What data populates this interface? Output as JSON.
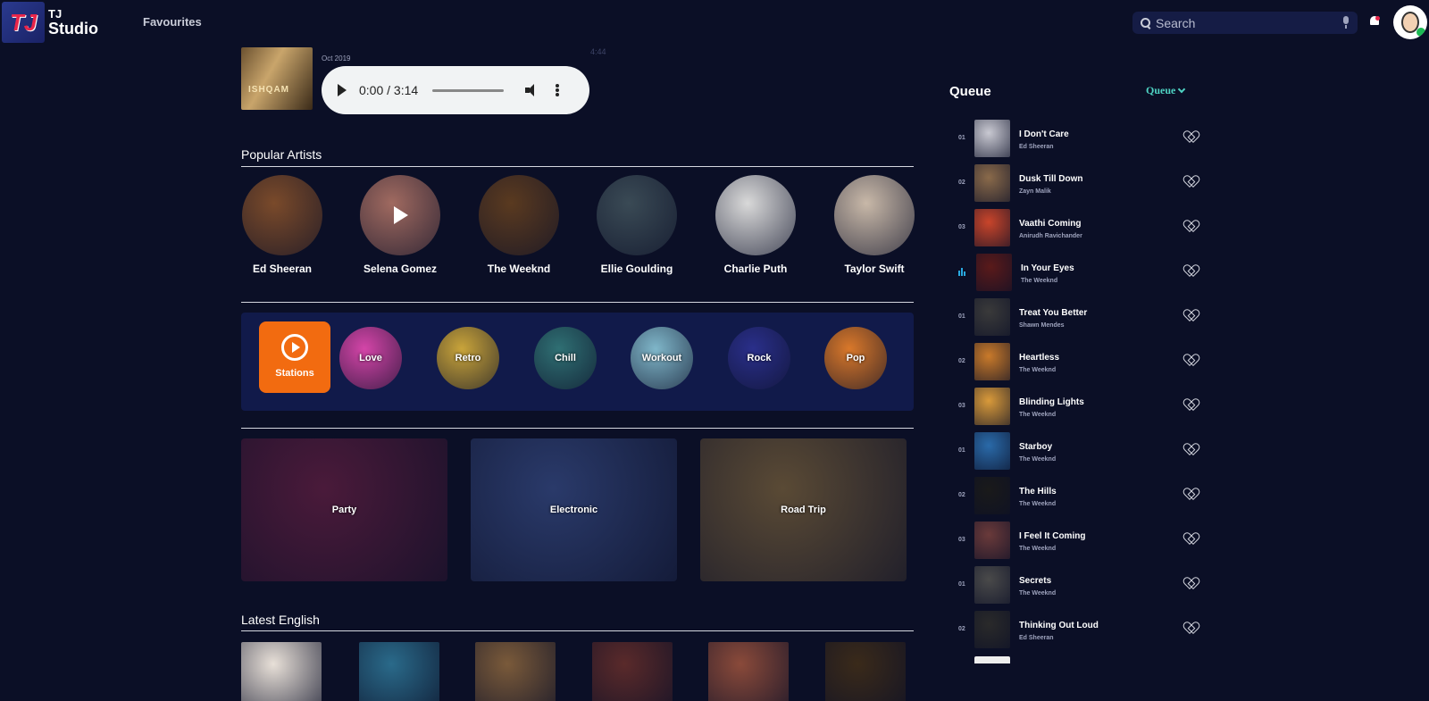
{
  "header": {
    "logo_mark": "TJ",
    "logo_line1": "TJ",
    "logo_line2": "Studio",
    "nav_favourites": "Favourites",
    "search_placeholder": "Search"
  },
  "now_playing": {
    "cover_label": "ISHQAM",
    "date": "Oct 2019",
    "duration": "4:44",
    "player_time": "0:00 / 3:14"
  },
  "popular_artists": {
    "title": "Popular Artists",
    "items": [
      {
        "name": "Ed Sheeran",
        "color": "#7a4a2a"
      },
      {
        "name": "Selena Gomez",
        "color": "#a06a60"
      },
      {
        "name": "The Weeknd",
        "color": "#5a3a20"
      },
      {
        "name": "Ellie Goulding",
        "color": "#3a4a55"
      },
      {
        "name": "Charlie Puth",
        "color": "#d9d9d9"
      },
      {
        "name": "Taylor Swift",
        "color": "#c8b8a8"
      }
    ]
  },
  "stations": {
    "label": "Stations",
    "genres": [
      {
        "name": "Love",
        "color": "#d445a8"
      },
      {
        "name": "Retro",
        "color": "#c9a43a"
      },
      {
        "name": "Chill",
        "color": "#2f6f73"
      },
      {
        "name": "Workout",
        "color": "#7fb6c9"
      },
      {
        "name": "Rock",
        "color": "#2a2f8a"
      },
      {
        "name": "Pop",
        "color": "#d9782a"
      }
    ]
  },
  "moods": [
    {
      "name": "Party",
      "color": "#4a1a3a"
    },
    {
      "name": "Electronic",
      "color": "#2a3a6a"
    },
    {
      "name": "Road Trip",
      "color": "#5a4a35"
    }
  ],
  "latest_english": {
    "title": "Latest English",
    "colors": [
      "#e8e0d8",
      "#2a6a8a",
      "#7a5a3a",
      "#5a2a2a",
      "#8a4a3a",
      "#3a2a1a"
    ]
  },
  "queue": {
    "title": "Queue",
    "dropdown": "Queue",
    "items": [
      {
        "num": "01",
        "song": "I Don't Care",
        "artist": "Ed Sheeran",
        "color": "#c9c9d2"
      },
      {
        "num": "02",
        "song": "Dusk Till Down",
        "artist": "Zayn Malik",
        "color": "#8a6a4a"
      },
      {
        "num": "03",
        "song": "Vaathi Coming",
        "artist": "Anirudh Ravichander",
        "color": "#c9452a"
      },
      {
        "num": "",
        "song": "In Your Eyes",
        "artist": "The Weeknd",
        "color": "#5a1a1a",
        "playing": true
      },
      {
        "num": "01",
        "song": "Treat You Better",
        "artist": "Shawn Mendes",
        "color": "#3a3a3a"
      },
      {
        "num": "02",
        "song": "Heartless",
        "artist": "The Weeknd",
        "color": "#c97a2a"
      },
      {
        "num": "03",
        "song": "Blinding Lights",
        "artist": "The Weeknd",
        "color": "#d99a3a"
      },
      {
        "num": "01",
        "song": "Starboy",
        "artist": "The Weeknd",
        "color": "#2a6aa9"
      },
      {
        "num": "02",
        "song": "The Hills",
        "artist": "The Weeknd",
        "color": "#1a1a1a"
      },
      {
        "num": "03",
        "song": "I Feel It Coming",
        "artist": "The Weeknd",
        "color": "#6a3a3a"
      },
      {
        "num": "01",
        "song": "Secrets",
        "artist": "The Weeknd",
        "color": "#4a4a4a"
      },
      {
        "num": "02",
        "song": "Thinking Out Loud",
        "artist": "Ed Sheeran",
        "color": "#2a2a2a"
      }
    ]
  }
}
